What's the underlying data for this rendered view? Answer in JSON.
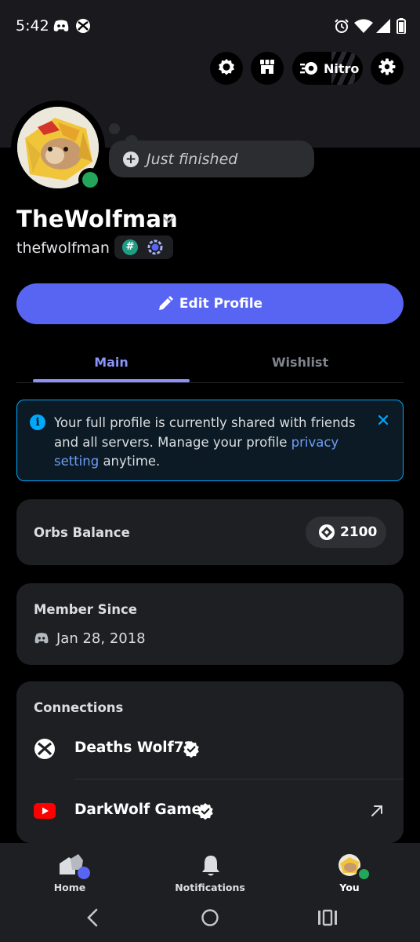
{
  "status_bar": {
    "time": "5:42",
    "left_icons": [
      "discord-icon",
      "xbox-icon"
    ],
    "right_icons": [
      "alarm-icon",
      "wifi-icon",
      "signal-icon",
      "battery-icon"
    ]
  },
  "top_actions": {
    "buttons": [
      "quests-icon",
      "shop-icon",
      "settings-gear-icon"
    ],
    "nitro_label": "Nitro"
  },
  "profile": {
    "status_text": "Just finished",
    "display_name": "TheWolfman",
    "username": "thefwolfman",
    "badge_hash": "#",
    "online_color": "#23a55a"
  },
  "edit_profile_label": "Edit Profile",
  "tabs": [
    {
      "label": "Main",
      "active": true
    },
    {
      "label": "Wishlist",
      "active": false
    }
  ],
  "info_notice": {
    "text_before": "Your full profile is currently shared with friends and all servers. Manage your profile ",
    "link_text": "privacy setting",
    "text_after": " anytime."
  },
  "orbs": {
    "label": "Orbs Balance",
    "value": "2100"
  },
  "member_since": {
    "label": "Member Since",
    "date": "Jan 28, 2018"
  },
  "connections": {
    "label": "Connections",
    "items": [
      {
        "service": "xbox",
        "name": "Deaths Wolf72",
        "verified": true,
        "external": false
      },
      {
        "service": "youtube",
        "name": "DarkWolf Gamer",
        "verified": true,
        "external": true
      }
    ]
  },
  "bottom_nav": [
    {
      "label": "Home",
      "active": false
    },
    {
      "label": "Notifications",
      "active": false
    },
    {
      "label": "You",
      "active": true
    }
  ],
  "colors": {
    "accent": "#5865f2",
    "tab_active": "#8b93f8",
    "info_border": "#00a8fc",
    "link": "#6f9cf6",
    "youtube": "#ff0000"
  }
}
